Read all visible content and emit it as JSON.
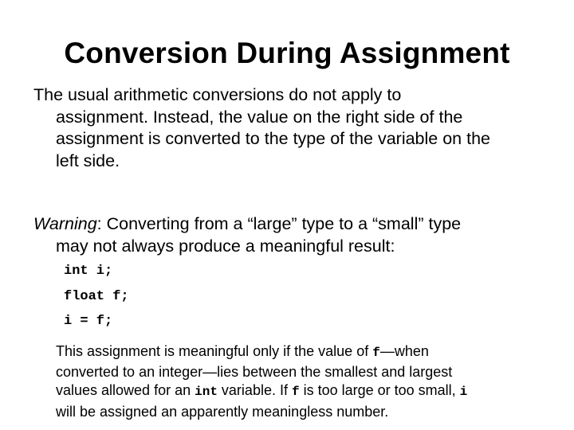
{
  "slide": {
    "title": "Conversion During Assignment",
    "paragraph1": {
      "lines": [
        "The usual arithmetic conversions do not apply to",
        "assignment. Instead, the value on the right side of the",
        "assignment is converted to the type of the variable on the",
        "left side."
      ]
    },
    "paragraph2": {
      "label": "Warning",
      "line1_rest": ": Converting from a “large” type to a “small” type",
      "line2": "may not always produce a meaningful result:"
    },
    "code": [
      "int i;",
      "float f;",
      "i = f;"
    ],
    "note": {
      "line1_a": "This assignment is meaningful only if the value of ",
      "line1_code": "f",
      "line1_b": "—when",
      "line2": "converted to an integer—lies between the smallest and largest",
      "line3_a": "values allowed for an ",
      "line3_code1": "int",
      "line3_b": " variable. If ",
      "line3_code2": "f",
      "line3_c": " is too large or too small, ",
      "line3_code3": "i",
      "line4": "will be assigned an apparently meaningless number."
    }
  }
}
